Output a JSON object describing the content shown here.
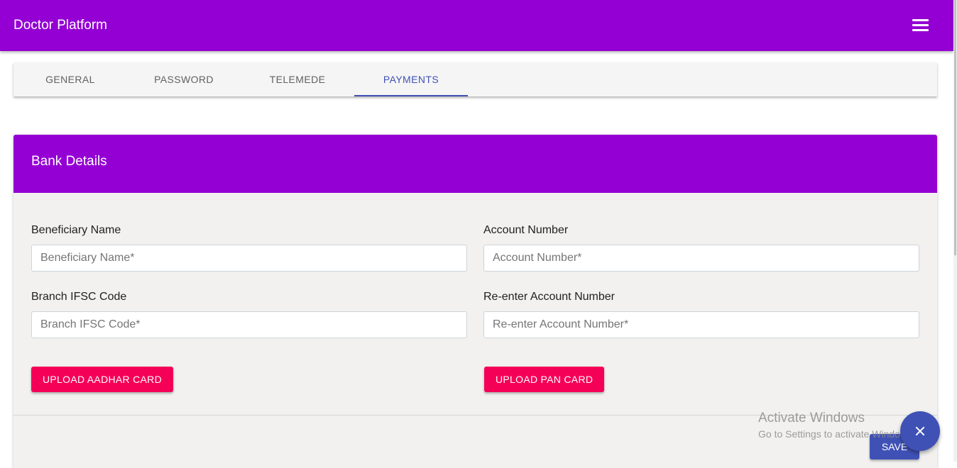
{
  "app": {
    "title": "Doctor Platform"
  },
  "tabs": [
    {
      "label": "GENERAL"
    },
    {
      "label": "PASSWORD"
    },
    {
      "label": "TELEMEDE"
    },
    {
      "label": "PAYMENTS"
    }
  ],
  "active_tab": "PAYMENTS",
  "bank_details": {
    "title": "Bank Details",
    "fields": {
      "beneficiary_name": {
        "label": "Beneficiary Name",
        "placeholder": "Beneficiary Name*",
        "value": ""
      },
      "account_number": {
        "label": "Account Number",
        "placeholder": "Account Number*",
        "value": ""
      },
      "branch_ifsc": {
        "label": "Branch IFSC Code",
        "placeholder": "Branch IFSC Code*",
        "value": ""
      },
      "reenter_account": {
        "label": "Re-enter Account Number",
        "placeholder": "Re-enter Account Number*",
        "value": ""
      }
    },
    "upload_aadhar_label": "UPLOAD AADHAR CARD",
    "upload_pan_label": "UPLOAD PAN CARD",
    "save_label": "SAVE"
  },
  "watermark": {
    "title": "Activate Windows",
    "subtitle": "Go to Settings to activate Windows."
  },
  "icons": {
    "menu": "hamburger-menu-icon",
    "fab": "close-icon"
  },
  "colors": {
    "brand": "#9400d3",
    "accent": "#f50057",
    "primary": "#3f51b5"
  }
}
